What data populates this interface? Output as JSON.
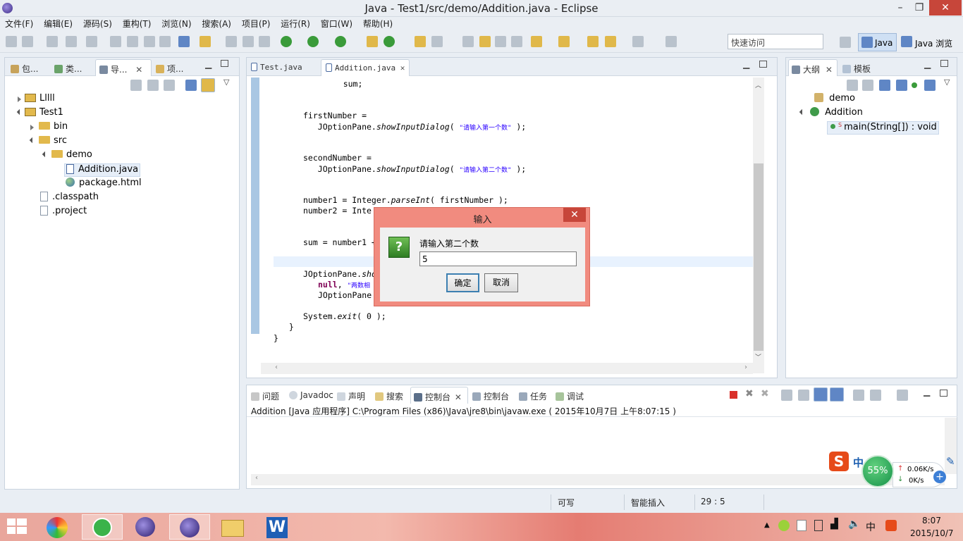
{
  "window": {
    "title": "Java  -  Test1/src/demo/Addition.java  -  Eclipse",
    "min": "–",
    "max": "❐",
    "close": "✕"
  },
  "menu": [
    "文件(F)",
    "编辑(E)",
    "源码(S)",
    "重构(T)",
    "浏览(N)",
    "搜索(A)",
    "项目(P)",
    "运行(R)",
    "窗口(W)",
    "帮助(H)"
  ],
  "toolbar": {
    "quick_access": "快速访问",
    "perspective_java": "Java",
    "perspective_browse": "Java 浏览"
  },
  "left_panel": {
    "tabs": [
      "包...",
      "类...",
      "导...",
      "项..."
    ],
    "tree": [
      {
        "label": "Lllll",
        "type": "project",
        "level": 0,
        "state": "closed"
      },
      {
        "label": "Test1",
        "type": "project",
        "level": 0,
        "state": "open"
      },
      {
        "label": "bin",
        "type": "folder",
        "level": 1,
        "state": "closed"
      },
      {
        "label": "src",
        "type": "folder",
        "level": 1,
        "state": "open"
      },
      {
        "label": "demo",
        "type": "folder",
        "level": 2,
        "state": "open"
      },
      {
        "label": "Addition.java",
        "type": "java",
        "level": 3,
        "state": "selected"
      },
      {
        "label": "package.html",
        "type": "html",
        "level": 3,
        "state": "none"
      },
      {
        "label": ".classpath",
        "type": "file",
        "level": 1,
        "state": "none"
      },
      {
        "label": ".project",
        "type": "file",
        "level": 1,
        "state": "none"
      }
    ]
  },
  "editor": {
    "tabs": [
      "Test.java",
      "Addition.java"
    ],
    "lines": {
      "l1": "    sum;",
      "l2a": "firstNumber =",
      "l2b_pre": "   JOptionPane.",
      "l2b_m": "showInputDialog",
      "l2b_open": "( ",
      "l2b_s": "\"请输入第一个数\"",
      "l2b_close": " );",
      "l3a": "secondNumber =",
      "l3b_pre": "   JOptionPane.",
      "l3b_m": "showInputDialog",
      "l3b_open": "( ",
      "l3b_s": "\"请输入第二个数\"",
      "l3b_close": " );",
      "l4_pre": "number1 = Integer.",
      "l4_m": "parseInt",
      "l4_post": "( firstNumber );",
      "l5": "number2 = Inte",
      "l6": "sum = number1 +",
      "l7_pre": "JOptionPane.",
      "l7_m": "sho",
      "l8_kw": "null",
      "l8_s": "\"两数相",
      "l9": "JOptionPane",
      "l10_pre": "System.",
      "l10_m": "exit",
      "l10_post": "( 0 );",
      "l11": "  }",
      "l12": "}"
    }
  },
  "outline": {
    "tabs": [
      "大纲",
      "模板"
    ],
    "items": [
      {
        "label": "demo",
        "kind": "package"
      },
      {
        "label": "Addition",
        "kind": "class"
      },
      {
        "label": "main(String[]) : void",
        "kind": "method"
      }
    ]
  },
  "bottom": {
    "tabs": [
      "问题",
      "Javadoc",
      "声明",
      "搜索",
      "控制台",
      "控制台",
      "任务",
      "调试"
    ],
    "console_line": "Addition [Java 应用程序] C:\\Program Files (x86)\\Java\\jre8\\bin\\javaw.exe ( 2015年10月7日 上午8:07:15 )"
  },
  "dialog": {
    "title": "输入",
    "prompt": "请输入第二个数",
    "value": "5",
    "ok": "确定",
    "cancel": "取消",
    "icon": "?"
  },
  "status": {
    "writable": "可写",
    "insert_mode": "智能插入",
    "position": "29 : 5"
  },
  "net_widget": {
    "percent": "55%",
    "up": "0.06K/s",
    "down": "0K/s"
  },
  "ime": {
    "lang": "中"
  },
  "tray": {
    "ime": "中",
    "time": "8:07",
    "date": "2015/10/7"
  },
  "colors": {
    "accent": "#3c7fb1",
    "dialog_frame": "#f18b7f",
    "close_red": "#c7463a"
  }
}
